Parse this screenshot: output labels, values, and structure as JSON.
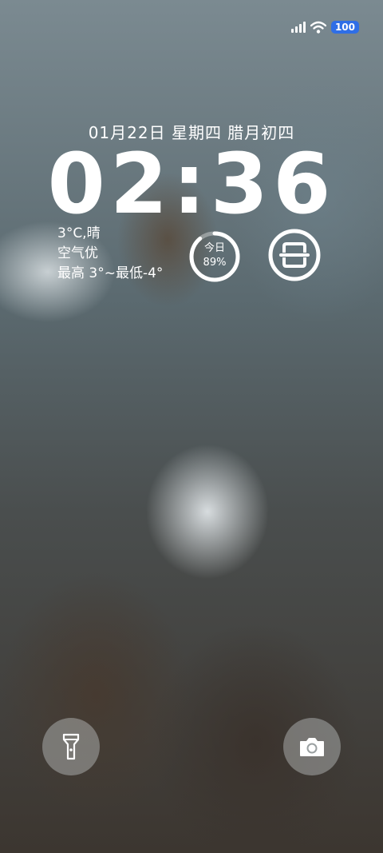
{
  "status_bar": {
    "battery": "100",
    "signal_icon": "cellular-signal-icon",
    "wifi_icon": "wifi-icon"
  },
  "lockscreen": {
    "date": "01月22日 星期四 腊月初四",
    "time": "02:36",
    "weather": {
      "temp_condition": "3°C,晴",
      "air_quality": "空气优",
      "range": "最高 3°~最低-4°"
    },
    "step_widget": {
      "label": "今日",
      "percent_text": "89%",
      "progress": 0.89
    },
    "scan_icon": "scan-icon"
  },
  "bottom": {
    "left_icon": "flashlight-icon",
    "right_icon": "camera-icon"
  },
  "colors": {
    "battery_badge": "#2f6ee6"
  }
}
